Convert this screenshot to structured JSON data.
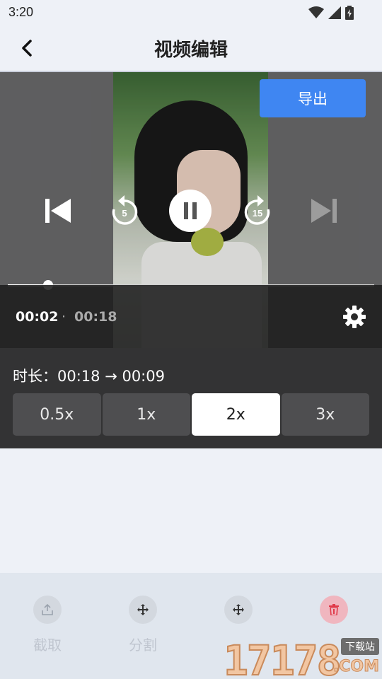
{
  "status_bar": {
    "time": "3:20"
  },
  "header": {
    "title": "视频编辑",
    "back_icon": "chevron-left-icon"
  },
  "video": {
    "export_label": "导出",
    "rewind_label": "5",
    "forward_label": "15",
    "progress": 0.111,
    "current_time": "00:02",
    "separator": "·",
    "total_time": "00:18"
  },
  "speed": {
    "duration_text": "时长：00:18 → 00:09",
    "options": [
      "0.5x",
      "1x",
      "2x",
      "3x"
    ],
    "selected": "2x"
  },
  "toolbar": {
    "items": [
      {
        "label": "截取",
        "icon": "share-upload-icon"
      },
      {
        "label": "分割",
        "icon": "move-arrows-icon"
      },
      {
        "label": "",
        "icon": "move-arrows-icon"
      },
      {
        "label": "",
        "icon": "trash-icon"
      }
    ]
  },
  "watermark": {
    "digits": "17178",
    "tag": "下载站",
    "com": ".COM"
  },
  "colors": {
    "accent": "#3f86f2",
    "delete": "#e03a4a"
  }
}
